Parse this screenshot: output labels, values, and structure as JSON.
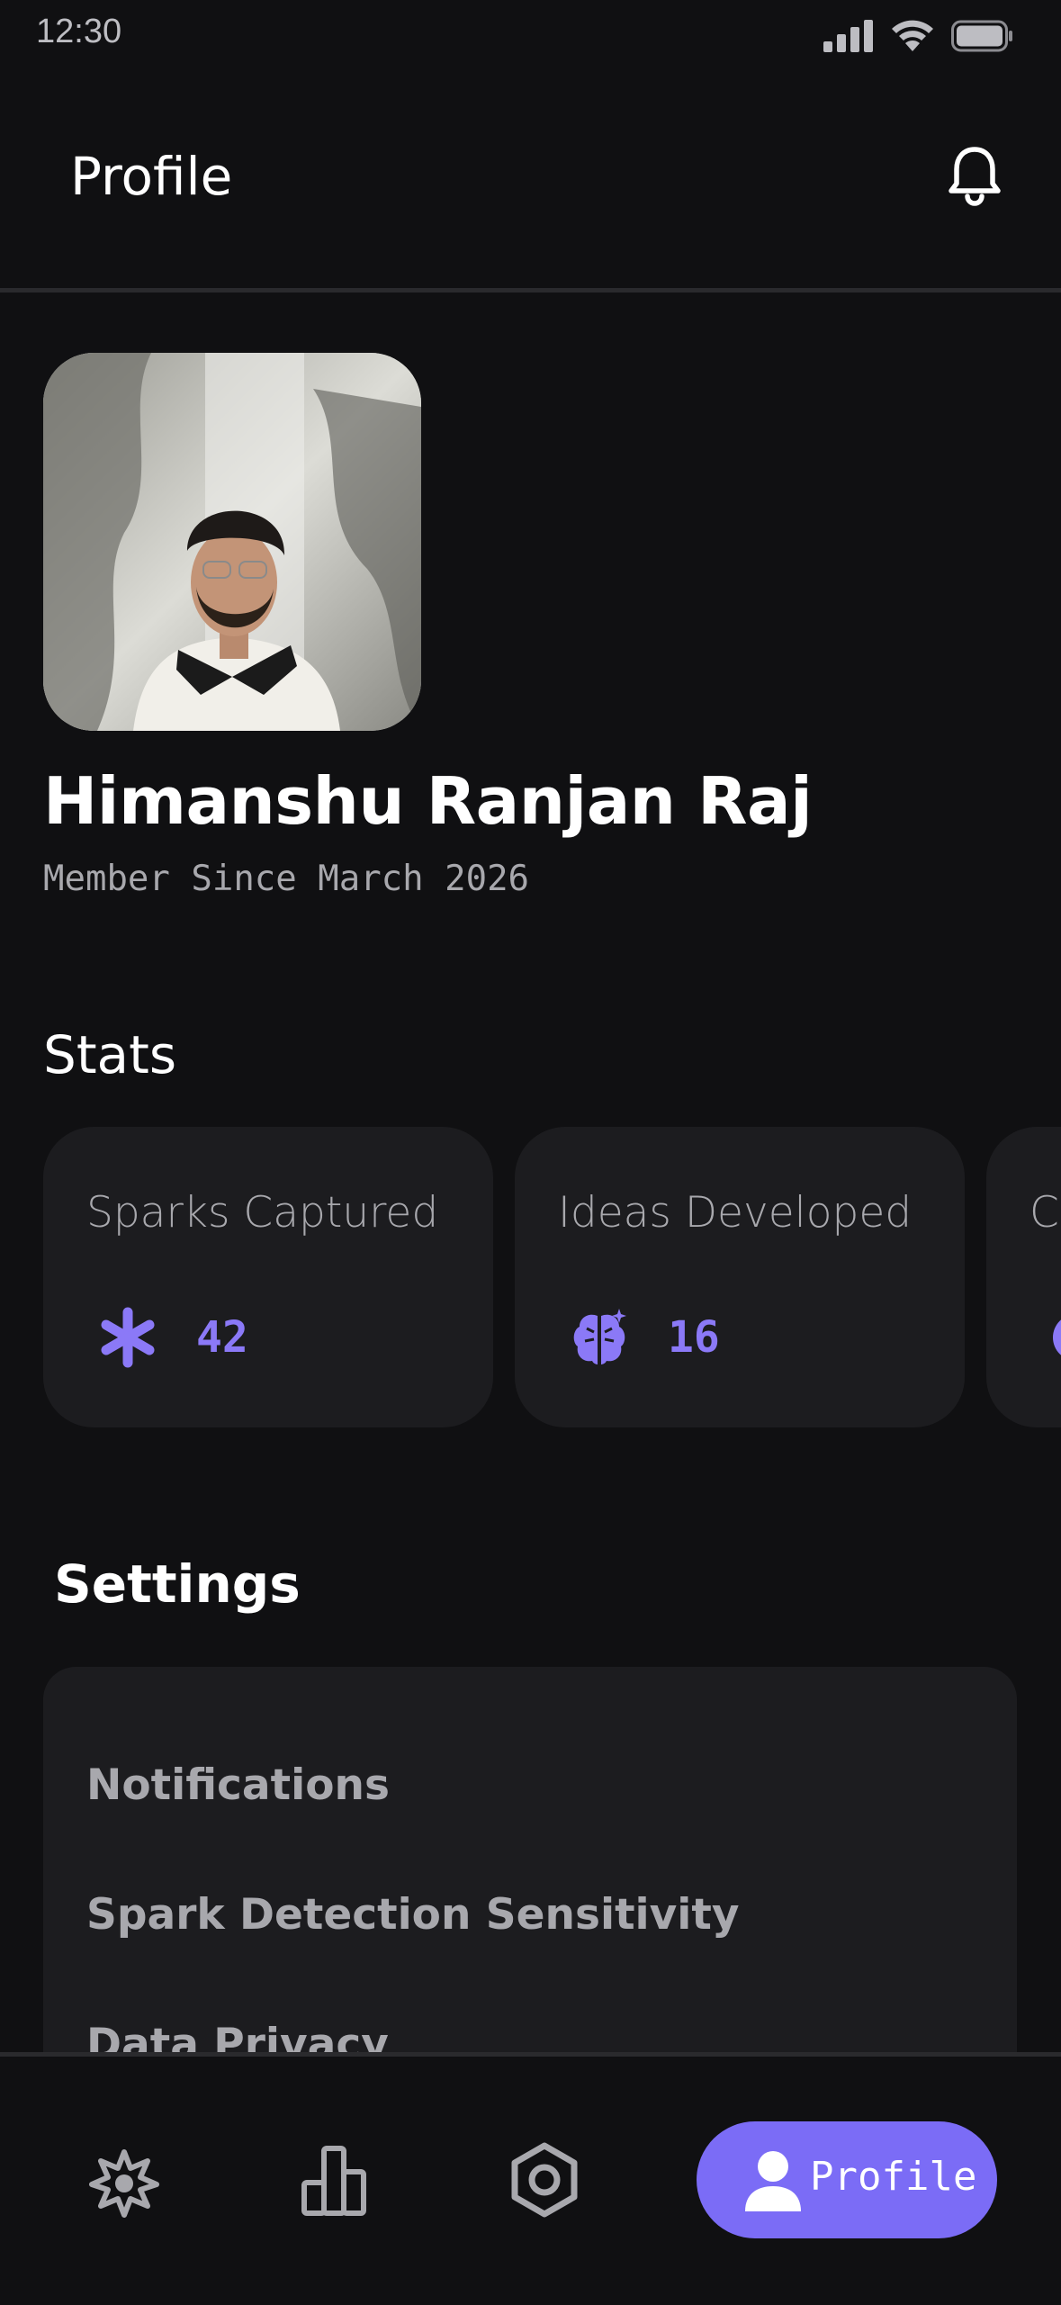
{
  "status_bar": {
    "time": "12:30"
  },
  "header": {
    "title": "Profile"
  },
  "profile": {
    "name": "Himanshu Ranjan Raj",
    "member_since": "Member Since March 2026"
  },
  "stats": {
    "title": "Stats",
    "cards": [
      {
        "label": "Sparks Captured",
        "value": "42",
        "icon": "sparkle-icon"
      },
      {
        "label": "Ideas Developed",
        "value": "16",
        "icon": "brain-icon"
      },
      {
        "label": "C",
        "value": "",
        "icon": "circle-icon"
      }
    ]
  },
  "settings": {
    "title": "Settings",
    "items": [
      "Notifications",
      "Spark Detection Sensitivity",
      "Data Privacy"
    ]
  },
  "nav": {
    "items": [
      {
        "icon": "spark-icon"
      },
      {
        "icon": "chart-icon"
      },
      {
        "icon": "settings-icon"
      },
      {
        "icon": "user-icon",
        "label": "Profile",
        "active": true
      }
    ]
  },
  "colors": {
    "accent": "#7b6cf6",
    "background": "#101012",
    "card": "#1c1c1f"
  }
}
